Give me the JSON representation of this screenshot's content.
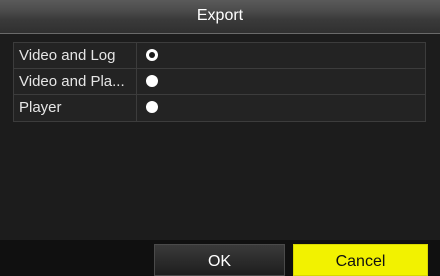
{
  "dialog": {
    "title": "Export"
  },
  "options": [
    {
      "label": "Video and Log",
      "checked": true
    },
    {
      "label": "Video and Pla...",
      "checked": false
    },
    {
      "label": "Player",
      "checked": false
    }
  ],
  "buttons": {
    "ok_label": "OK",
    "cancel_label": "Cancel"
  },
  "colors": {
    "background": "#1c1c1c",
    "accent_button": "#f2f200"
  }
}
